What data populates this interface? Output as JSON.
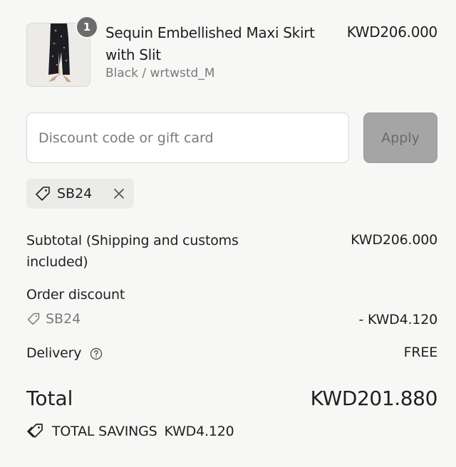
{
  "product": {
    "quantity": "1",
    "title": "Sequin Embellished Maxi Skirt with Slit",
    "variant": "Black / wrtwstd_M",
    "price": "KWD206.000",
    "image_icon": "sequin-skirt-thumbnail"
  },
  "discount": {
    "placeholder": "Discount code or gift card",
    "apply_label": "Apply",
    "applied_code": "SB24"
  },
  "summary": {
    "subtotal_label": "Subtotal (Shipping and customs included)",
    "subtotal_value": "KWD206.000",
    "order_discount_label": "Order discount",
    "discount_code": "SB24",
    "discount_value": "- KWD4.120",
    "delivery_label": "Delivery",
    "delivery_value": "FREE",
    "total_label": "Total",
    "total_value": "KWD201.880",
    "savings_label": "TOTAL SAVINGS",
    "savings_value": "KWD4.120"
  },
  "colors": {
    "background": "#f7f7f6",
    "apply_button": "#a5a5a5",
    "chip_background": "#ebebea",
    "badge": "#6c6c6c"
  }
}
